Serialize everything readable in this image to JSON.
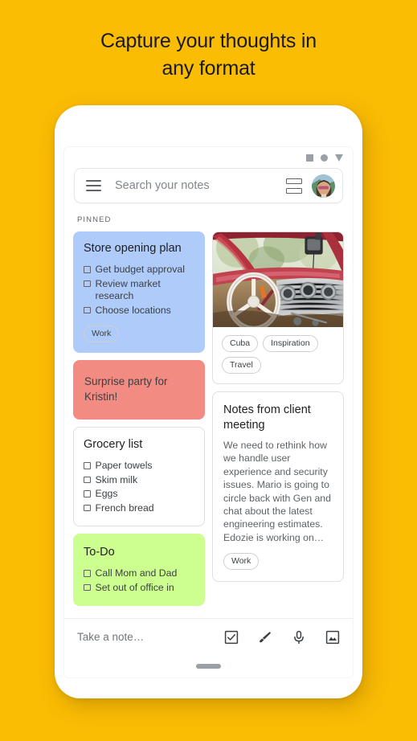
{
  "headline": {
    "line1": "Capture your thoughts in",
    "line2": "any format"
  },
  "colors": {
    "background": "#fbbc04",
    "note_blue": "#aecbfa",
    "note_salmon": "#f28b82",
    "note_green": "#ccff90",
    "note_white": "#ffffff"
  },
  "statusbar": {
    "icon_square": "square-icon",
    "icon_circle": "circle-icon",
    "icon_triangle": "triangle-down-icon"
  },
  "search": {
    "placeholder": "Search your notes",
    "menu_icon": "hamburger-menu-icon",
    "view_toggle_icon": "list-view-icon",
    "avatar_icon": "user-avatar"
  },
  "notes": {
    "section_label": "PINNED",
    "left_column": [
      {
        "id": "store-opening-plan",
        "type": "checklist",
        "color": "#aecbfa",
        "title": "Store opening plan",
        "items": [
          "Get budget approval",
          "Review market research",
          "Choose locations"
        ],
        "chips": [
          "Work"
        ]
      },
      {
        "id": "surprise-party",
        "type": "plain",
        "color": "#f28b82",
        "text": "Surprise party for Kristin!"
      },
      {
        "id": "grocery-list",
        "type": "checklist",
        "color": "#ffffff",
        "title": "Grocery list",
        "items": [
          "Paper towels",
          "Skim milk",
          "Eggs",
          "French bread"
        ],
        "chips": []
      },
      {
        "id": "to-do",
        "type": "checklist",
        "color": "#ccff90",
        "title": "To-Do",
        "items": [
          "Call Mom and Dad",
          "Set out of office in"
        ],
        "chips": []
      }
    ],
    "right_column": [
      {
        "id": "photo-note",
        "type": "photo",
        "color": "#ffffff",
        "image_alt": "vintage car interior with white steering wheel and chrome dashboard",
        "chips": [
          "Cuba",
          "Inspiration",
          "Travel"
        ]
      },
      {
        "id": "client-meeting-note",
        "type": "text",
        "color": "#ffffff",
        "title": "Notes from client meeting",
        "body": "We need to rethink how we handle user experience and security issues. Mario is going to circle back with Gen and chat about the latest engineering estimates. Edozie is working on…",
        "chips": [
          "Work"
        ]
      }
    ]
  },
  "notebar": {
    "placeholder": "Take a note…",
    "tools": [
      {
        "name": "checklist-icon",
        "label": "New list"
      },
      {
        "name": "brush-icon",
        "label": "New drawing"
      },
      {
        "name": "microphone-icon",
        "label": "New recording"
      },
      {
        "name": "image-icon",
        "label": "New note with image"
      }
    ]
  }
}
